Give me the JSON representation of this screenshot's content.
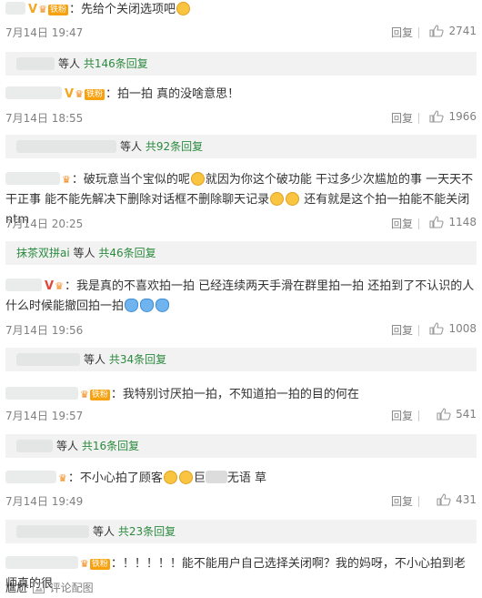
{
  "colors": {
    "link": "#2b8a3e",
    "meta": "#808080",
    "reply_bg": "#f2f2f2",
    "badge": "#f6a10d"
  },
  "icons": {
    "like": "thumbs-up-icon",
    "comment": "comment-icon",
    "image": "image-icon",
    "vip": "vip-badge-icon",
    "fan": "fan-badge-icon"
  },
  "labels": {
    "reply": "回复",
    "fan_badge": "铁粉"
  },
  "comments": [
    {
      "text": "：先给个关闭选项吧",
      "time": "7月14日 19:47",
      "likes": "2741",
      "reply_prefix": "等人 ",
      "reply_count": "共146条回复"
    },
    {
      "text": "：拍一拍  真的没啥意思！",
      "time": "7月14日 18:55",
      "likes": "1966",
      "reply_prefix": "等人 ",
      "reply_count": "共92条回复"
    },
    {
      "text_a": "：破玩意当个宝似的呢",
      "text_b": "就因为你这个破功能 干过多少次尴尬的事  一天天不干正事 能不能先解决下删除对话框不删除聊天记录",
      "text_c": "还有就是这个拍一拍能不能关闭 ntm",
      "time": "7月14日 20:25",
      "likes": "1148",
      "reply_name": "抹茶双拼ai",
      "reply_prefix": " 等人 ",
      "reply_count": "共46条回复"
    },
    {
      "text": "：我是真的不喜欢拍一拍 已经连续两天手滑在群里拍一拍 还拍到了不认识的人 什么时候能撤回拍一拍",
      "time": "7月14日 19:56",
      "likes": "1008",
      "reply_prefix": "等人 ",
      "reply_count": "共34条回复"
    },
    {
      "text": "：我特别讨厌拍一拍，不知道拍一拍的目的何在",
      "time": "7月14日 19:57",
      "likes": "541",
      "reply_prefix": "等人 ",
      "reply_count": "共16条回复"
    },
    {
      "text_a": "：不小心拍了顾客",
      "text_b": "巨",
      "text_c": "无语 草",
      "time": "7月14日 19:49",
      "likes": "431",
      "reply_prefix": "等人 ",
      "reply_count": "共23条回复"
    },
    {
      "text": "：！！！！！能不能用户自己选择关闭啊？我的妈呀，不小心拍到老师真的很"
    }
  ],
  "bottom": {
    "text": "尴尬",
    "link": "评论配图"
  }
}
